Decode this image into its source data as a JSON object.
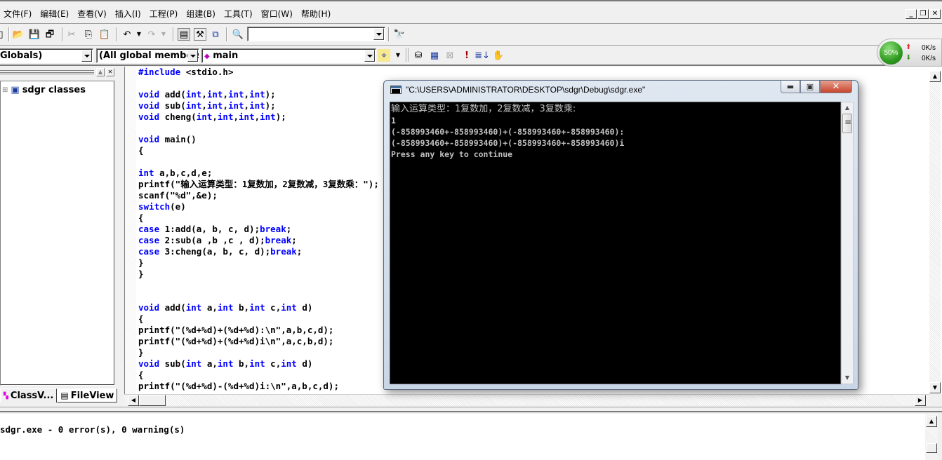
{
  "menubar": {
    "items": [
      "文件(F)",
      "编辑(E)",
      "查看(V)",
      "插入(I)",
      "工程(P)",
      "组建(B)",
      "工具(T)",
      "窗口(W)",
      "帮助(H)"
    ],
    "mdi_controls": {
      "minimize": "_",
      "restore": "❐",
      "close": "✕"
    }
  },
  "toolbar": {
    "find_combo_value": "",
    "icons": [
      "new-icon",
      "open-icon",
      "save-icon",
      "save-all-icon",
      "cut-icon",
      "copy-icon",
      "paste-icon",
      "undo-icon",
      "redo-icon",
      "workspace-icon",
      "output-icon",
      "window-list-icon",
      "find-in-files-icon",
      "search-icon"
    ]
  },
  "wizardbar": {
    "class_combo": "Globals)",
    "filter_combo": "(All global members",
    "members_combo": "main",
    "build_icons": [
      "compile-icon",
      "build-icon",
      "stop-build-icon",
      "execute-icon",
      "go-icon",
      "breakpoint-icon"
    ]
  },
  "netmon": {
    "percent": "50%",
    "upload": "0K/s",
    "download": "0K/s"
  },
  "workspace": {
    "tree_root": "sdgr classes",
    "tabs": [
      "ClassV...",
      "FileView"
    ]
  },
  "editor": {
    "lines": [
      [
        [
          "pp",
          "#include"
        ],
        [
          "t",
          " <stdio.h>"
        ]
      ],
      [],
      [
        [
          "kw",
          "void"
        ],
        [
          "t",
          " add("
        ],
        [
          "kw",
          "int"
        ],
        [
          "t",
          ","
        ],
        [
          "kw",
          "int"
        ],
        [
          "t",
          ","
        ],
        [
          "kw",
          "int"
        ],
        [
          "t",
          ","
        ],
        [
          "kw",
          "int"
        ],
        [
          "t",
          ");"
        ]
      ],
      [
        [
          "kw",
          "void"
        ],
        [
          "t",
          " sub("
        ],
        [
          "kw",
          "int"
        ],
        [
          "t",
          ","
        ],
        [
          "kw",
          "int"
        ],
        [
          "t",
          ","
        ],
        [
          "kw",
          "int"
        ],
        [
          "t",
          ","
        ],
        [
          "kw",
          "int"
        ],
        [
          "t",
          ");"
        ]
      ],
      [
        [
          "kw",
          "void"
        ],
        [
          "t",
          " cheng("
        ],
        [
          "kw",
          "int"
        ],
        [
          "t",
          ","
        ],
        [
          "kw",
          "int"
        ],
        [
          "t",
          ","
        ],
        [
          "kw",
          "int"
        ],
        [
          "t",
          ","
        ],
        [
          "kw",
          "int"
        ],
        [
          "t",
          ");"
        ]
      ],
      [],
      [
        [
          "kw",
          "void"
        ],
        [
          "t",
          " main()"
        ]
      ],
      [
        [
          "t",
          "{"
        ]
      ],
      [],
      [
        [
          "kw",
          "int"
        ],
        [
          "t",
          " a,b,c,d,e;"
        ]
      ],
      [
        [
          "t",
          "printf(\"输入运算类型：1复数加，2复数减，3复数乘：\");"
        ]
      ],
      [
        [
          "t",
          "scanf(\"%d\",&e);"
        ]
      ],
      [
        [
          "kw",
          "switch"
        ],
        [
          "t",
          "(e)"
        ]
      ],
      [
        [
          "t",
          "{"
        ]
      ],
      [
        [
          "kw",
          "case"
        ],
        [
          "t",
          " 1:add(a, b, c, d);"
        ],
        [
          "kw",
          "break"
        ],
        [
          "t",
          ";"
        ]
      ],
      [
        [
          "kw",
          "case"
        ],
        [
          "t",
          " 2:sub(a ,b ,c , d);"
        ],
        [
          "kw",
          "break"
        ],
        [
          "t",
          ";"
        ]
      ],
      [
        [
          "kw",
          "case"
        ],
        [
          "t",
          " 3:cheng(a, b, c, d);"
        ],
        [
          "kw",
          "break"
        ],
        [
          "t",
          ";"
        ]
      ],
      [
        [
          "t",
          "}"
        ]
      ],
      [
        [
          "t",
          "}"
        ]
      ],
      [],
      [],
      [
        [
          "kw",
          "void"
        ],
        [
          "t",
          " add("
        ],
        [
          "kw",
          "int"
        ],
        [
          "t",
          " a,"
        ],
        [
          "kw",
          "int"
        ],
        [
          "t",
          " b,"
        ],
        [
          "kw",
          "int"
        ],
        [
          "t",
          " c,"
        ],
        [
          "kw",
          "int"
        ],
        [
          "t",
          " d)"
        ]
      ],
      [
        [
          "t",
          "{"
        ]
      ],
      [
        [
          "t",
          "printf(\"(%d+%d)+(%d+%d):\\n\",a,b,c,d);"
        ]
      ],
      [
        [
          "t",
          "printf(\"(%d+%d)+(%d+%d)i\\n\",a,c,b,d);"
        ]
      ],
      [
        [
          "t",
          "}"
        ]
      ],
      [
        [
          "kw",
          "void"
        ],
        [
          "t",
          " sub("
        ],
        [
          "kw",
          "int"
        ],
        [
          "t",
          " a,"
        ],
        [
          "kw",
          "int"
        ],
        [
          "t",
          " b,"
        ],
        [
          "kw",
          "int"
        ],
        [
          "t",
          " c,"
        ],
        [
          "kw",
          "int"
        ],
        [
          "t",
          " d)"
        ]
      ],
      [
        [
          "t",
          "{"
        ]
      ],
      [
        [
          "t",
          "printf(\"(%d+%d)-(%d+%d)i:\\n\",a,b,c,d);"
        ]
      ]
    ]
  },
  "output": {
    "text": "sdgr.exe - 0 error(s), 0 warning(s)"
  },
  "console": {
    "title": "\"C:\\USERS\\ADMINISTRATOR\\DESKTOP\\sdgr\\Debug\\sdgr.exe\"",
    "lines": [
      "输入运算类型：1复数加，2复数减，3复数乘:",
      "1",
      "(-858993460+-858993460)+(-858993460+-858993460):",
      "(-858993460+-858993460)+(-858993460+-858993460)i",
      "Press any key to continue"
    ]
  }
}
